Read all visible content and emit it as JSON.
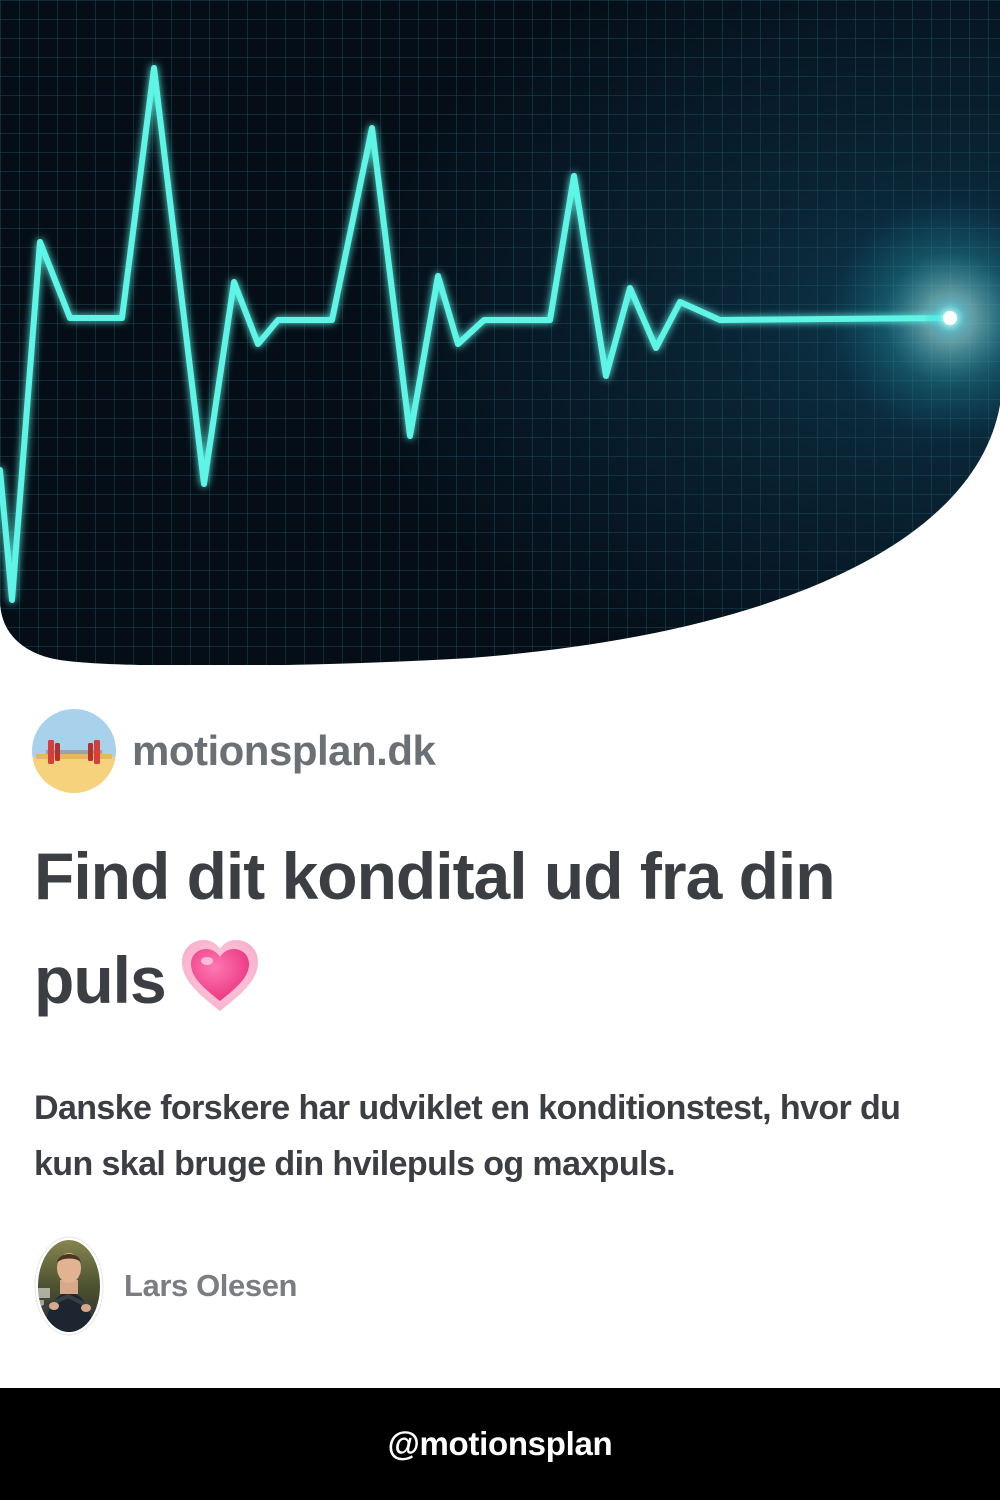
{
  "hero": {
    "image": "heartbeat-ecg-monitor",
    "colors": {
      "background": "#06121c",
      "grid": "#1d5566",
      "trace": "#5ff5e6"
    }
  },
  "site": {
    "logo_icon": "dumbbell-beach-icon",
    "name": "motionsplan.dk"
  },
  "article": {
    "title": "Find dit kondital ud fra din puls",
    "title_emoji": "growing-heart-icon",
    "subtitle": "Danske forskere har udviklet en konditionstest, hvor du kun skal bruge din hvilepuls og maxpuls."
  },
  "author": {
    "name": "Lars Olesen"
  },
  "footer": {
    "handle": "@motionsplan"
  },
  "colors": {
    "title_text": "#3b3e42",
    "muted_text": "#6b7075",
    "footer_bg": "#000000",
    "footer_text": "#ffffff"
  }
}
